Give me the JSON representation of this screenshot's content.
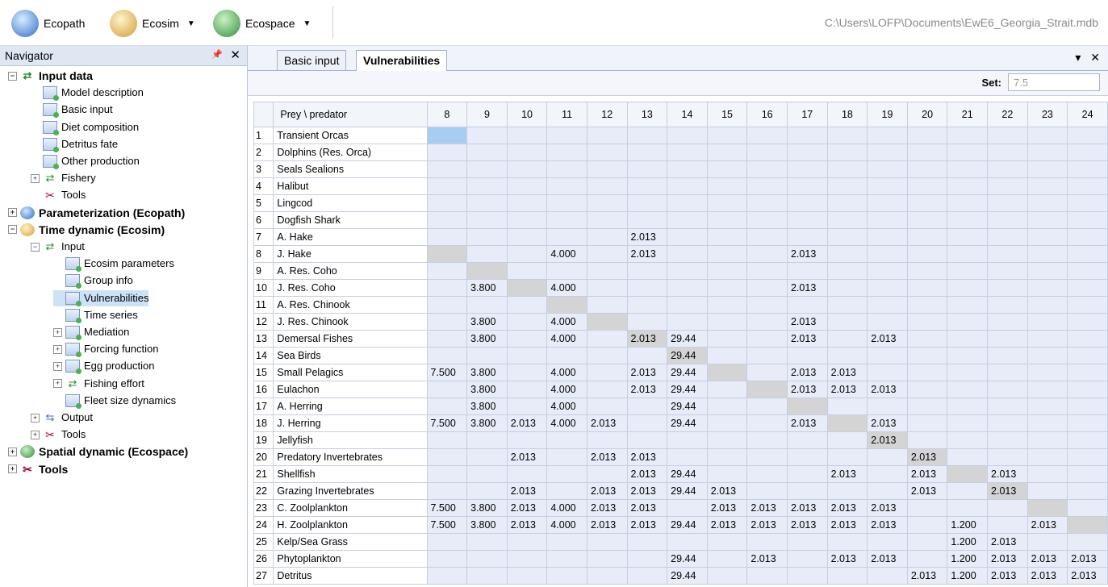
{
  "toolbar": {
    "ecopath_label": "Ecopath",
    "ecosim_label": "Ecosim",
    "ecospace_label": "Ecospace",
    "file_path": "C:\\Users\\LOFP\\Documents\\EwE6_Georgia_Strait.mdb"
  },
  "navigator": {
    "title": "Navigator",
    "items": [
      {
        "label": "Input data",
        "level": 0,
        "bold": true,
        "expander": "⊟",
        "icon": "arrows"
      },
      {
        "label": "Model description",
        "level": 1,
        "icon": "doc"
      },
      {
        "label": "Basic input",
        "level": 1,
        "icon": "doc"
      },
      {
        "label": "Diet composition",
        "level": 1,
        "icon": "doc"
      },
      {
        "label": "Detritus fate",
        "level": 1,
        "icon": "doc"
      },
      {
        "label": "Other production",
        "level": 1,
        "icon": "doc"
      },
      {
        "label": "Fishery",
        "level": 1,
        "expander": "⊞",
        "icon": "arrows"
      },
      {
        "label": "Tools",
        "level": 1,
        "icon": "tools"
      },
      {
        "label": "Parameterization (Ecopath)",
        "level": 0,
        "bold": true,
        "expander": "⊞",
        "icon": "globe-blue"
      },
      {
        "label": "Time dynamic (Ecosim)",
        "level": 0,
        "bold": true,
        "expander": "⊟",
        "icon": "globe-gold"
      },
      {
        "label": "Input",
        "level": 1,
        "expander": "⊟",
        "icon": "arrows"
      },
      {
        "label": "Ecosim parameters",
        "level": 2,
        "icon": "doc"
      },
      {
        "label": "Group info",
        "level": 2,
        "icon": "doc"
      },
      {
        "label": "Vulnerabilities",
        "level": 2,
        "icon": "doc",
        "selected": true
      },
      {
        "label": "Time series",
        "level": 2,
        "icon": "doc"
      },
      {
        "label": "Mediation",
        "level": 2,
        "expander": "⊞",
        "icon": "doc"
      },
      {
        "label": "Forcing function",
        "level": 2,
        "expander": "⊞",
        "icon": "doc"
      },
      {
        "label": "Egg production",
        "level": 2,
        "expander": "⊞",
        "icon": "doc"
      },
      {
        "label": "Fishing effort",
        "level": 2,
        "expander": "⊞",
        "icon": "arrows"
      },
      {
        "label": "Fleet size dynamics",
        "level": 2,
        "icon": "doc"
      },
      {
        "label": "Output",
        "level": 1,
        "expander": "⊞",
        "icon": "out"
      },
      {
        "label": "Tools",
        "level": 1,
        "expander": "⊞",
        "icon": "tools"
      },
      {
        "label": "Spatial dynamic  (Ecospace)",
        "level": 0,
        "bold": true,
        "expander": "⊞",
        "icon": "globe-green"
      },
      {
        "label": "Tools",
        "level": 0,
        "bold": true,
        "expander": "⊞",
        "icon": "tools"
      }
    ]
  },
  "tabs": [
    {
      "label": "Basic input",
      "active": false
    },
    {
      "label": "Vulnerabilities",
      "active": true
    }
  ],
  "set": {
    "label": "Set:",
    "value": "7.5"
  },
  "grid": {
    "corner_header": "Prey \\ predator",
    "columns": [
      "8",
      "9",
      "10",
      "11",
      "12",
      "13",
      "14",
      "15",
      "16",
      "17",
      "18",
      "19",
      "20",
      "21",
      "22",
      "23",
      "24"
    ],
    "rows": [
      {
        "idx": "1",
        "name": "Transient Orcas",
        "cells": [
          "",
          "",
          "",
          "",
          "",
          "",
          "",
          "",
          "",
          "",
          "",
          "",
          "",
          "",
          "",
          "",
          ""
        ]
      },
      {
        "idx": "2",
        "name": "Dolphins (Res. Orca)",
        "cells": [
          "",
          "",
          "",
          "",
          "",
          "",
          "",
          "",
          "",
          "",
          "",
          "",
          "",
          "",
          "",
          "",
          ""
        ]
      },
      {
        "idx": "3",
        "name": "Seals Sealions",
        "cells": [
          "",
          "",
          "",
          "",
          "",
          "",
          "",
          "",
          "",
          "",
          "",
          "",
          "",
          "",
          "",
          "",
          ""
        ]
      },
      {
        "idx": "4",
        "name": "Halibut",
        "cells": [
          "",
          "",
          "",
          "",
          "",
          "",
          "",
          "",
          "",
          "",
          "",
          "",
          "",
          "",
          "",
          "",
          ""
        ]
      },
      {
        "idx": "5",
        "name": "Lingcod",
        "cells": [
          "",
          "",
          "",
          "",
          "",
          "",
          "",
          "",
          "",
          "",
          "",
          "",
          "",
          "",
          "",
          "",
          ""
        ]
      },
      {
        "idx": "6",
        "name": "Dogfish Shark",
        "cells": [
          "",
          "",
          "",
          "",
          "",
          "",
          "",
          "",
          "",
          "",
          "",
          "",
          "",
          "",
          "",
          "",
          ""
        ]
      },
      {
        "idx": "7",
        "name": "A. Hake",
        "cells": [
          "",
          "",
          "",
          "",
          "",
          "2.013",
          "",
          "",
          "",
          "",
          "",
          "",
          "",
          "",
          "",
          "",
          ""
        ]
      },
      {
        "idx": "8",
        "name": "J. Hake",
        "cells": [
          "",
          "",
          "",
          "4.000",
          "",
          "2.013",
          "",
          "",
          "",
          "2.013",
          "",
          "",
          "",
          "",
          "",
          "",
          ""
        ]
      },
      {
        "idx": "9",
        "name": "A. Res. Coho",
        "cells": [
          "",
          "",
          "",
          "",
          "",
          "",
          "",
          "",
          "",
          "",
          "",
          "",
          "",
          "",
          "",
          "",
          ""
        ]
      },
      {
        "idx": "10",
        "name": "J. Res. Coho",
        "cells": [
          "",
          "3.800",
          "",
          "4.000",
          "",
          "",
          "",
          "",
          "",
          "2.013",
          "",
          "",
          "",
          "",
          "",
          "",
          ""
        ]
      },
      {
        "idx": "11",
        "name": "A. Res. Chinook",
        "cells": [
          "",
          "",
          "",
          "",
          "",
          "",
          "",
          "",
          "",
          "",
          "",
          "",
          "",
          "",
          "",
          "",
          ""
        ]
      },
      {
        "idx": "12",
        "name": "J. Res. Chinook",
        "cells": [
          "",
          "3.800",
          "",
          "4.000",
          "",
          "",
          "",
          "",
          "",
          "2.013",
          "",
          "",
          "",
          "",
          "",
          "",
          ""
        ]
      },
      {
        "idx": "13",
        "name": "Demersal Fishes",
        "cells": [
          "",
          "3.800",
          "",
          "4.000",
          "",
          "2.013",
          "29.44",
          "",
          "",
          "2.013",
          "",
          "2.013",
          "",
          "",
          "",
          "",
          ""
        ]
      },
      {
        "idx": "14",
        "name": "Sea Birds",
        "cells": [
          "",
          "",
          "",
          "",
          "",
          "",
          "29.44",
          "",
          "",
          "",
          "",
          "",
          "",
          "",
          "",
          "",
          ""
        ]
      },
      {
        "idx": "15",
        "name": "Small Pelagics",
        "cells": [
          "7.500",
          "3.800",
          "",
          "4.000",
          "",
          "2.013",
          "29.44",
          "",
          "",
          "2.013",
          "2.013",
          "",
          "",
          "",
          "",
          "",
          ""
        ]
      },
      {
        "idx": "16",
        "name": "Eulachon",
        "cells": [
          "",
          "3.800",
          "",
          "4.000",
          "",
          "2.013",
          "29.44",
          "",
          "",
          "2.013",
          "2.013",
          "2.013",
          "",
          "",
          "",
          "",
          ""
        ]
      },
      {
        "idx": "17",
        "name": "A. Herring",
        "cells": [
          "",
          "3.800",
          "",
          "4.000",
          "",
          "",
          "29.44",
          "",
          "",
          "",
          "",
          "",
          "",
          "",
          "",
          "",
          ""
        ]
      },
      {
        "idx": "18",
        "name": "J. Herring",
        "cells": [
          "7.500",
          "3.800",
          "2.013",
          "4.000",
          "2.013",
          "",
          "29.44",
          "",
          "",
          "2.013",
          "",
          "2.013",
          "",
          "",
          "",
          "",
          ""
        ]
      },
      {
        "idx": "19",
        "name": "Jellyfish",
        "cells": [
          "",
          "",
          "",
          "",
          "",
          "",
          "",
          "",
          "",
          "",
          "",
          "2.013",
          "",
          "",
          "",
          "",
          ""
        ]
      },
      {
        "idx": "20",
        "name": "Predatory Invertebrates",
        "cells": [
          "",
          "",
          "2.013",
          "",
          "2.013",
          "2.013",
          "",
          "",
          "",
          "",
          "",
          "",
          "2.013",
          "",
          "",
          "",
          ""
        ]
      },
      {
        "idx": "21",
        "name": "Shellfish",
        "cells": [
          "",
          "",
          "",
          "",
          "",
          "2.013",
          "29.44",
          "",
          "",
          "",
          "2.013",
          "",
          "2.013",
          "",
          "2.013",
          "",
          ""
        ]
      },
      {
        "idx": "22",
        "name": "Grazing Invertebrates",
        "cells": [
          "",
          "",
          "2.013",
          "",
          "2.013",
          "2.013",
          "29.44",
          "2.013",
          "",
          "",
          "",
          "",
          "2.013",
          "",
          "2.013",
          "",
          ""
        ]
      },
      {
        "idx": "23",
        "name": "C. Zoolplankton",
        "cells": [
          "7.500",
          "3.800",
          "2.013",
          "4.000",
          "2.013",
          "2.013",
          "",
          "2.013",
          "2.013",
          "2.013",
          "2.013",
          "2.013",
          "",
          "",
          "",
          "",
          ""
        ]
      },
      {
        "idx": "24",
        "name": "H. Zoolplankton",
        "cells": [
          "7.500",
          "3.800",
          "2.013",
          "4.000",
          "2.013",
          "2.013",
          "29.44",
          "2.013",
          "2.013",
          "2.013",
          "2.013",
          "2.013",
          "",
          "1.200",
          "",
          "2.013",
          ""
        ]
      },
      {
        "idx": "25",
        "name": "Kelp/Sea Grass",
        "cells": [
          "",
          "",
          "",
          "",
          "",
          "",
          "",
          "",
          "",
          "",
          "",
          "",
          "",
          "1.200",
          "2.013",
          "",
          ""
        ]
      },
      {
        "idx": "26",
        "name": "Phytoplankton",
        "cells": [
          "",
          "",
          "",
          "",
          "",
          "",
          "29.44",
          "",
          "2.013",
          "",
          "2.013",
          "2.013",
          "",
          "1.200",
          "2.013",
          "2.013",
          "2.013"
        ]
      },
      {
        "idx": "27",
        "name": "Detritus",
        "cells": [
          "",
          "",
          "",
          "",
          "",
          "",
          "29.44",
          "",
          "",
          "",
          "",
          "",
          "2.013",
          "1.200",
          "2.013",
          "2.013",
          "2.013"
        ]
      }
    ]
  }
}
